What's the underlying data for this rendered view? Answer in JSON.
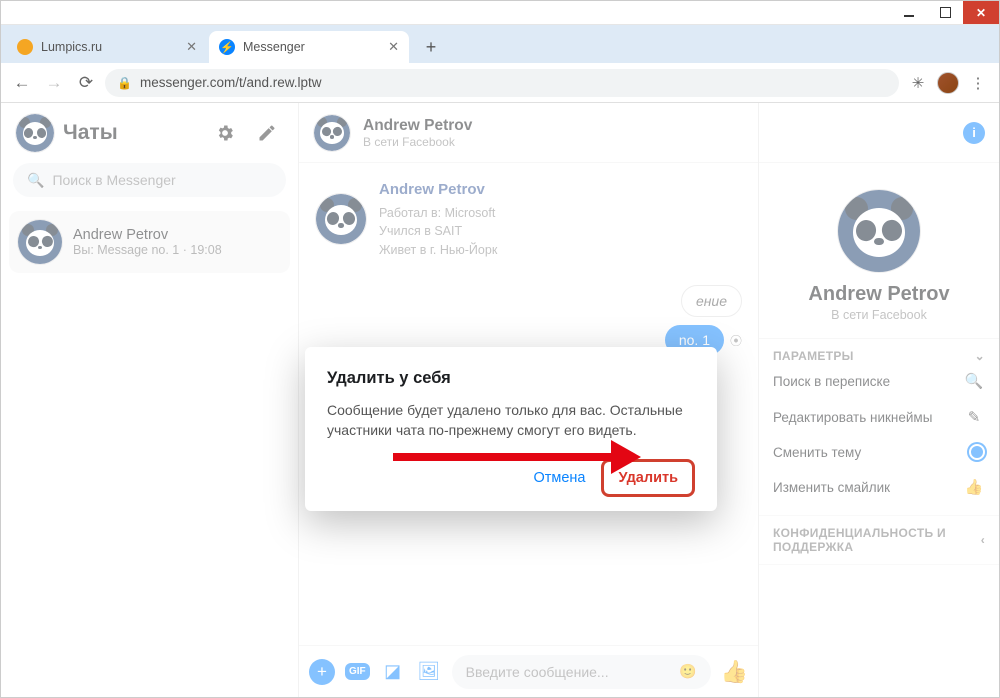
{
  "window": {
    "tabs": [
      {
        "title": "Lumpics.ru",
        "favicon_color": "#f5a623",
        "active": false
      },
      {
        "title": "Messenger",
        "favicon_color": "#0a84ff",
        "active": true
      }
    ],
    "address": "messenger.com/t/and.rew.lptw"
  },
  "sidebar": {
    "title": "Чаты",
    "search_placeholder": "Поиск в Messenger",
    "chats": [
      {
        "name": "Andrew Petrov",
        "subtitle": "Вы: Message no. 1 · 19:08"
      }
    ]
  },
  "conversation": {
    "header": {
      "name": "Andrew Petrov",
      "status": "В сети Facebook"
    },
    "contact_card": {
      "name": "Andrew Petrov",
      "lines": [
        "Работал в: Microsoft",
        "Учился в SAIT",
        "Живет в г. Нью-Йорк"
      ]
    },
    "messages": {
      "outlined_partial": "ение",
      "blue_partial": "no. 1"
    },
    "composer_placeholder": "Введите сообщение..."
  },
  "rightpanel": {
    "name": "Andrew Petrov",
    "status": "В сети Facebook",
    "section_params": "ПАРАМЕТРЫ",
    "rows": {
      "search": "Поиск в переписке",
      "nicknames": "Редактировать никнеймы",
      "theme": "Сменить тему",
      "emoji": "Изменить смайлик"
    },
    "section_privacy": "КОНФИДЕНЦИАЛЬНОСТЬ И ПОДДЕРЖКА"
  },
  "modal": {
    "title": "Удалить у себя",
    "body": "Сообщение будет удалено только для вас. Остальные участники чата по-прежнему смогут его видеть.",
    "cancel": "Отмена",
    "delete": "Удалить"
  },
  "icons": {
    "gif": "GIF"
  }
}
